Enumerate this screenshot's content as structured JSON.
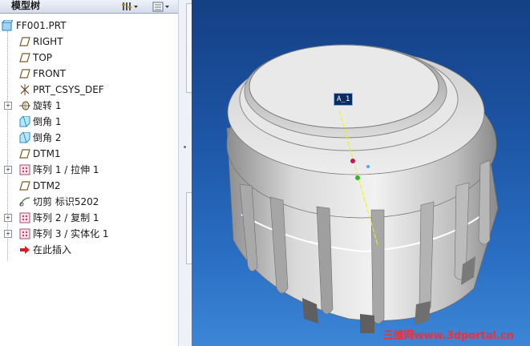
{
  "tree": {
    "title": "模型树",
    "root": "FF001.PRT",
    "items": [
      {
        "label": "RIGHT",
        "icon": "datum-plane-icon",
        "expandable": false
      },
      {
        "label": "TOP",
        "icon": "datum-plane-icon",
        "expandable": false
      },
      {
        "label": "FRONT",
        "icon": "datum-plane-icon",
        "expandable": false
      },
      {
        "label": "PRT_CSYS_DEF",
        "icon": "coordinate-system-icon",
        "expandable": false
      },
      {
        "label": "旋转 1",
        "icon": "revolve-icon",
        "expandable": true
      },
      {
        "label": "倒角 1",
        "icon": "chamfer-icon",
        "expandable": false
      },
      {
        "label": "倒角 2",
        "icon": "chamfer-icon",
        "expandable": false
      },
      {
        "label": "DTM1",
        "icon": "datum-plane-icon",
        "expandable": false
      },
      {
        "label": "阵列 1 / 拉伸 1",
        "icon": "pattern-icon",
        "expandable": true
      },
      {
        "label": "DTM2",
        "icon": "datum-plane-icon",
        "expandable": false
      },
      {
        "label": "切剪 标识5202",
        "icon": "cut-icon",
        "expandable": false
      },
      {
        "label": "阵列 2 / 复制 1",
        "icon": "pattern-icon",
        "expandable": true
      },
      {
        "label": "阵列 3 / 实体化 1",
        "icon": "pattern-icon",
        "expandable": true
      },
      {
        "label": "在此插入",
        "icon": "insert-here-arrow-icon",
        "expandable": false
      }
    ]
  },
  "toolbar": {
    "settings_icon": "tree-settings-icon",
    "show_icon": "tree-show-icon"
  },
  "viewport": {
    "axis_label": "A_1",
    "watermark": "三维网www.3dportal.cn",
    "colors": {
      "background_top": "#143f84",
      "background_bottom": "#3d86d6",
      "axis": "#f2f200",
      "watermark": "#ff2a2a"
    }
  }
}
